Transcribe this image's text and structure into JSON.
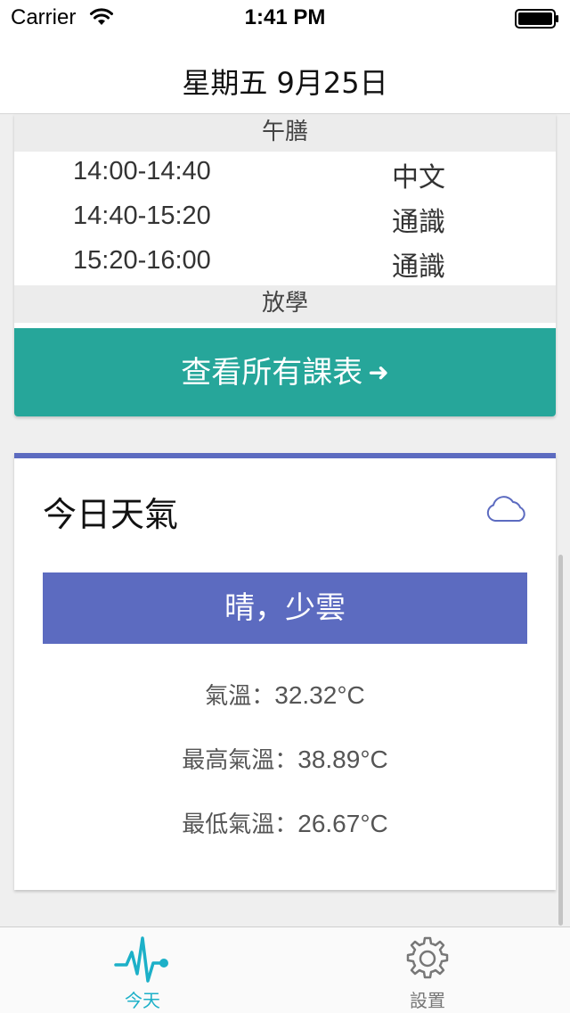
{
  "status_bar": {
    "carrier": "Carrier",
    "time": "1:41 PM",
    "icons": [
      "wifi-icon",
      "battery-icon"
    ]
  },
  "header": {
    "title": "星期五 9月25日"
  },
  "schedule": {
    "lunch_label": "午膳",
    "periods": [
      {
        "time": "14:00-14:40",
        "subject": "中文"
      },
      {
        "time": "14:40-15:20",
        "subject": "通識"
      },
      {
        "time": "15:20-16:00",
        "subject": "通識"
      }
    ],
    "dismissal_label": "放學",
    "view_all_label": "查看所有課表",
    "view_all_icon": "arrow-right-icon"
  },
  "weather": {
    "title": "今日天氣",
    "icon": "cloud-icon",
    "condition": "晴，少雲",
    "temp_label": "氣溫：",
    "temp_value": "32.32°C",
    "max_label": "最高氣溫：",
    "max_value": "38.89°C",
    "min_label": "最低氣溫：",
    "min_value": "26.67°C"
  },
  "tabs": [
    {
      "label": "今天",
      "icon": "pulse-icon",
      "active": true
    },
    {
      "label": "設置",
      "icon": "gear-icon",
      "active": false
    }
  ],
  "colors": {
    "accent_teal": "#26a69a",
    "weather_indigo": "#5c6bc0",
    "active_tab": "#1cb0c8",
    "inactive_tab": "#777777"
  }
}
